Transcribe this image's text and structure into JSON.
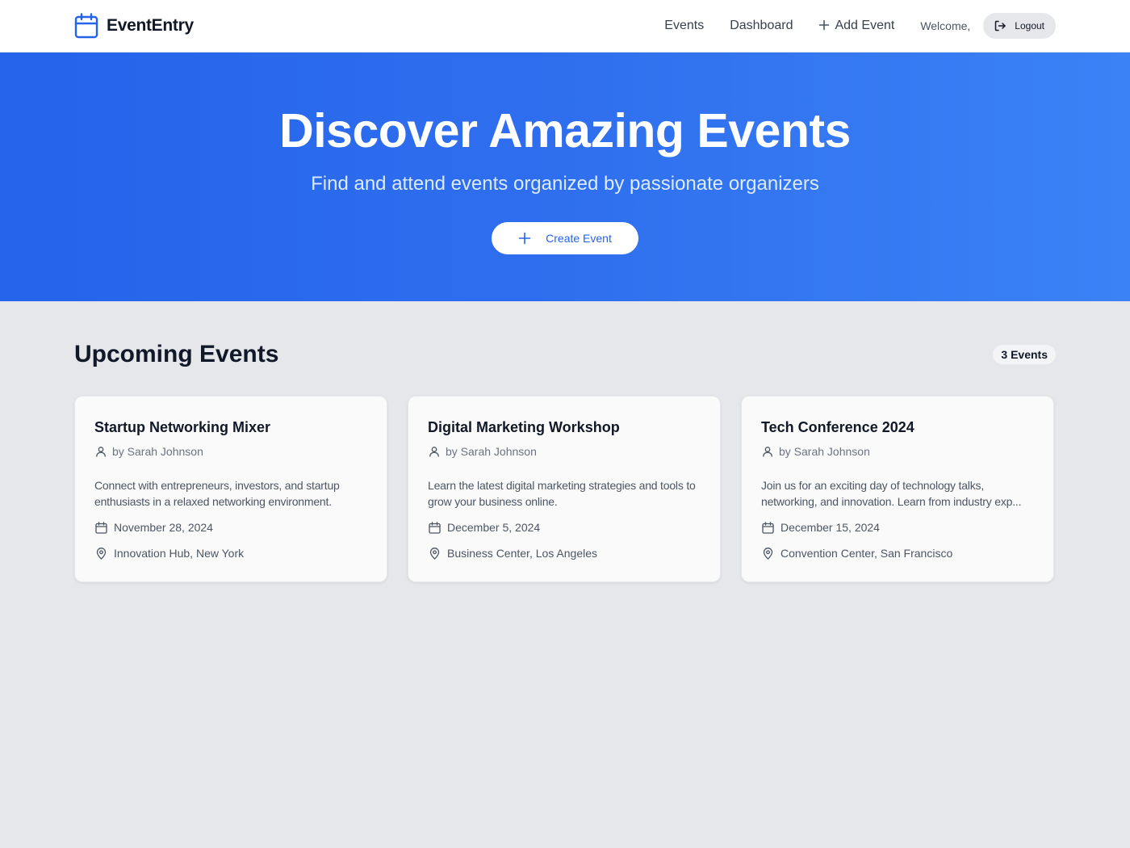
{
  "header": {
    "brand": "EventEntry",
    "nav": {
      "events": "Events",
      "dashboard": "Dashboard",
      "add_event": "Add Event"
    },
    "welcome": "Welcome,",
    "logout": "Logout"
  },
  "hero": {
    "title": "Discover Amazing Events",
    "subtitle": "Find and attend events organized by passionate organizers",
    "cta": "Create Event"
  },
  "main": {
    "section_title": "Upcoming Events",
    "count": "3 Events",
    "events": [
      {
        "title": "Startup Networking Mixer",
        "organizer": "by Sarah Johnson",
        "description": "Connect with entrepreneurs, investors, and startup enthusiasts in a relaxed networking environment.",
        "date": "November 28, 2024",
        "location": "Innovation Hub, New York"
      },
      {
        "title": "Digital Marketing Workshop",
        "organizer": "by Sarah Johnson",
        "description": "Learn the latest digital marketing strategies and tools to grow your business online.",
        "date": "December 5, 2024",
        "location": "Business Center, Los Angeles"
      },
      {
        "title": "Tech Conference 2024",
        "organizer": "by Sarah Johnson",
        "description": "Join us for an exciting day of technology talks, networking, and innovation. Learn from industry exp...",
        "date": "December 15, 2024",
        "location": "Convention Center, San Francisco"
      }
    ]
  },
  "colors": {
    "primary": "#2563eb",
    "hero_start": "#2563eb",
    "hero_end": "#3b82f6",
    "page_bg": "#e5e7eb"
  },
  "icons": {
    "brand": "calendar-icon",
    "add": "plus-icon",
    "logout": "logout-icon",
    "organizer": "user-icon",
    "date": "calendar-icon",
    "location": "map-pin-icon"
  }
}
